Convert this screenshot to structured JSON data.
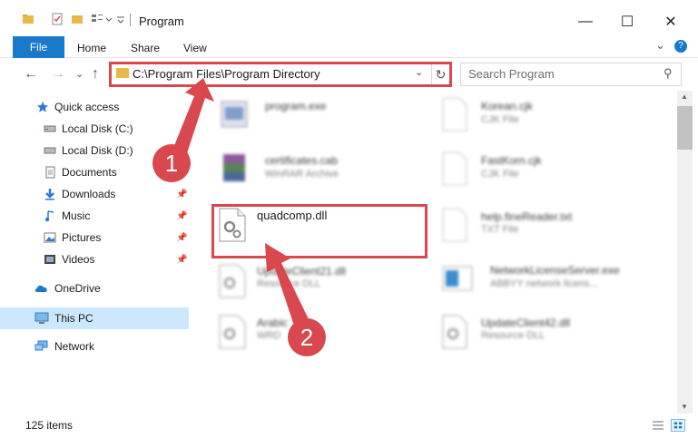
{
  "window": {
    "title": "Program",
    "minimize_glyph": "—",
    "maximize_glyph": "☐",
    "close_glyph": "✕"
  },
  "ribbon": {
    "file_tab": "File",
    "tabs": [
      "Home",
      "Share",
      "View"
    ],
    "expand_glyph": "⌄",
    "help_glyph": "?"
  },
  "nav": {
    "back_glyph": "←",
    "forward_glyph": "→",
    "recent_glyph": "⌄",
    "up_glyph": "↑"
  },
  "address": {
    "path": "C:\\Program Files\\Program Directory",
    "dropdown_glyph": "⌄",
    "refresh_glyph": "↻"
  },
  "search": {
    "placeholder": "Search Program",
    "icon_glyph": "⚲"
  },
  "sidebar": {
    "items": [
      {
        "label": "Quick access",
        "icon": "star-icon"
      },
      {
        "label": "Local Disk (C:)",
        "icon": "drive-icon"
      },
      {
        "label": "Local Disk (D:)",
        "icon": "drive-icon"
      },
      {
        "label": "Documents",
        "icon": "document-icon"
      },
      {
        "label": "Downloads",
        "icon": "download-icon",
        "pinned": true
      },
      {
        "label": "Music",
        "icon": "music-icon",
        "pinned": true
      },
      {
        "label": "Pictures",
        "icon": "picture-icon",
        "pinned": true
      },
      {
        "label": "Videos",
        "icon": "video-icon",
        "pinned": true
      },
      {
        "label": "OneDrive",
        "icon": "cloud-icon"
      },
      {
        "label": "This PC",
        "icon": "computer-icon",
        "selected": true
      },
      {
        "label": "Network",
        "icon": "network-icon"
      }
    ],
    "pin_glyph": "📌"
  },
  "files": {
    "left": [
      {
        "name": "program.exe",
        "type": ""
      },
      {
        "name": "certificates.cab",
        "type": "WinRAR Archive"
      },
      {
        "name": "quadcomp.dll",
        "type": ""
      },
      {
        "name": "UpdateClient21.dll",
        "type": "Resource DLL"
      },
      {
        "name": "Arabic",
        "type": "WRD"
      }
    ],
    "right": [
      {
        "name": "Korean.cjk",
        "type": "CJK File"
      },
      {
        "name": "FastKorn.cjk",
        "type": "CJK File"
      },
      {
        "name": "help.fineReader.txt",
        "type": "TXT File"
      },
      {
        "name": "NetworkLicenseServer.exe",
        "type": "ABBYY network licens..."
      },
      {
        "name": "UpdateClient42.dll",
        "type": "Resource DLL"
      }
    ]
  },
  "status": {
    "item_count": "125 items"
  },
  "annotations": {
    "badge1": "1",
    "badge2": "2",
    "color": "#d9474f"
  }
}
